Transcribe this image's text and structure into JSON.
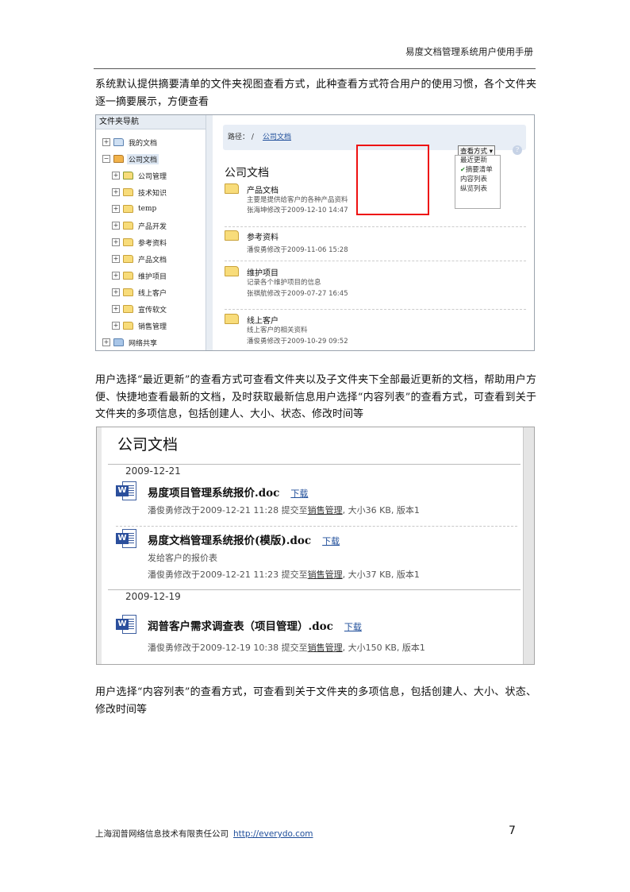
{
  "header": {
    "title": "易度文档管理系统用户使用手册"
  },
  "paragraphs": {
    "p1": "系统默认提供摘要清单的文件夹视图查看方式，此种查看方式符合用户的使用习惯，各个文件夹逐一摘要展示，方便查看",
    "p2": "用户选择“最近更新”的查看方式可查看文件夹以及子文件夹下全部最近更新的文档，帮助用户方便、快捷地查看最新的文档，及时获取最新信息用户选择“内容列表”的查看方式，可查看到关于文件夹的多项信息，包括创建人、大小、状态、修改时间等",
    "p3": "用户选择“内容列表”的查看方式，可查看到关于文件夹的多项信息，包括创建人、大小、状态、修改时间等"
  },
  "shot1": {
    "nav_title": "文件夹导航",
    "nav_items": [
      {
        "label": "我的文档",
        "toggle": "+"
      },
      {
        "label": "公司文档",
        "toggle": "−"
      },
      {
        "label": "公司管理",
        "toggle": "+"
      },
      {
        "label": "技术知识",
        "toggle": "+"
      },
      {
        "label": "temp",
        "toggle": "+"
      },
      {
        "label": "产品开发",
        "toggle": "+"
      },
      {
        "label": "参考资料",
        "toggle": "+"
      },
      {
        "label": "产品文档",
        "toggle": "+"
      },
      {
        "label": "维护项目",
        "toggle": "+"
      },
      {
        "label": "线上客户",
        "toggle": "+"
      },
      {
        "label": "宣传软文",
        "toggle": "+"
      },
      {
        "label": "销售管理",
        "toggle": "+"
      },
      {
        "label": "网络共享",
        "toggle": "+"
      }
    ],
    "breadcrumb_label": "路径：",
    "breadcrumb_sep": "/",
    "breadcrumb_link": "公司文档",
    "view_button": "查看方式 ▾",
    "help": "?",
    "view_menu": [
      "最近更新",
      "摘要清单",
      "内容列表",
      "纵览列表"
    ],
    "view_menu_checked": "✔",
    "page_title": "公司文档",
    "folders": [
      {
        "title": "产品文档",
        "desc": "主要是提供给客户的各种产品资料",
        "meta": "张海坤修改于2009-12-10 14:47"
      },
      {
        "title": "参考资料",
        "desc": "",
        "meta": "潘俊勇修改于2009-11-06 15:28"
      },
      {
        "title": "维护项目",
        "desc": "记录各个维护项目的信息",
        "meta": "张祺航修改于2009-07-27 16:45"
      },
      {
        "title": "线上客户",
        "desc": "线上客户的相关资料",
        "meta": "潘俊勇修改于2009-10-29 09:52"
      }
    ]
  },
  "shot2": {
    "page_title": "公司文档",
    "dates": [
      "2009-12-21",
      "2009-12-19"
    ],
    "download_label": "下载",
    "files": [
      {
        "name": "易度项目管理系统报价.doc",
        "desc": "",
        "meta_pre": "潘俊勇修改于2009-12-21 11:28 提交至",
        "meta_link": "销售管理",
        "meta_post": ", 大小36 KB, 版本1"
      },
      {
        "name": "易度文档管理系统报价(模版).doc",
        "desc": "发给客户的报价表",
        "meta_pre": "潘俊勇修改于2009-12-21 11:23 提交至",
        "meta_link": "销售管理",
        "meta_post": ", 大小37 KB, 版本1"
      },
      {
        "name": "润普客户需求调查表（项目管理）.doc",
        "desc": "",
        "meta_pre": "潘俊勇修改于2009-12-19 10:38 提交至",
        "meta_link": "销售管理",
        "meta_post": ", 大小150 KB, 版本1"
      }
    ],
    "icon_letter": "W"
  },
  "footer": {
    "company": "上海润普网络信息技术有限责任公司",
    "url": "http://everydo.com",
    "page_number": "7"
  }
}
